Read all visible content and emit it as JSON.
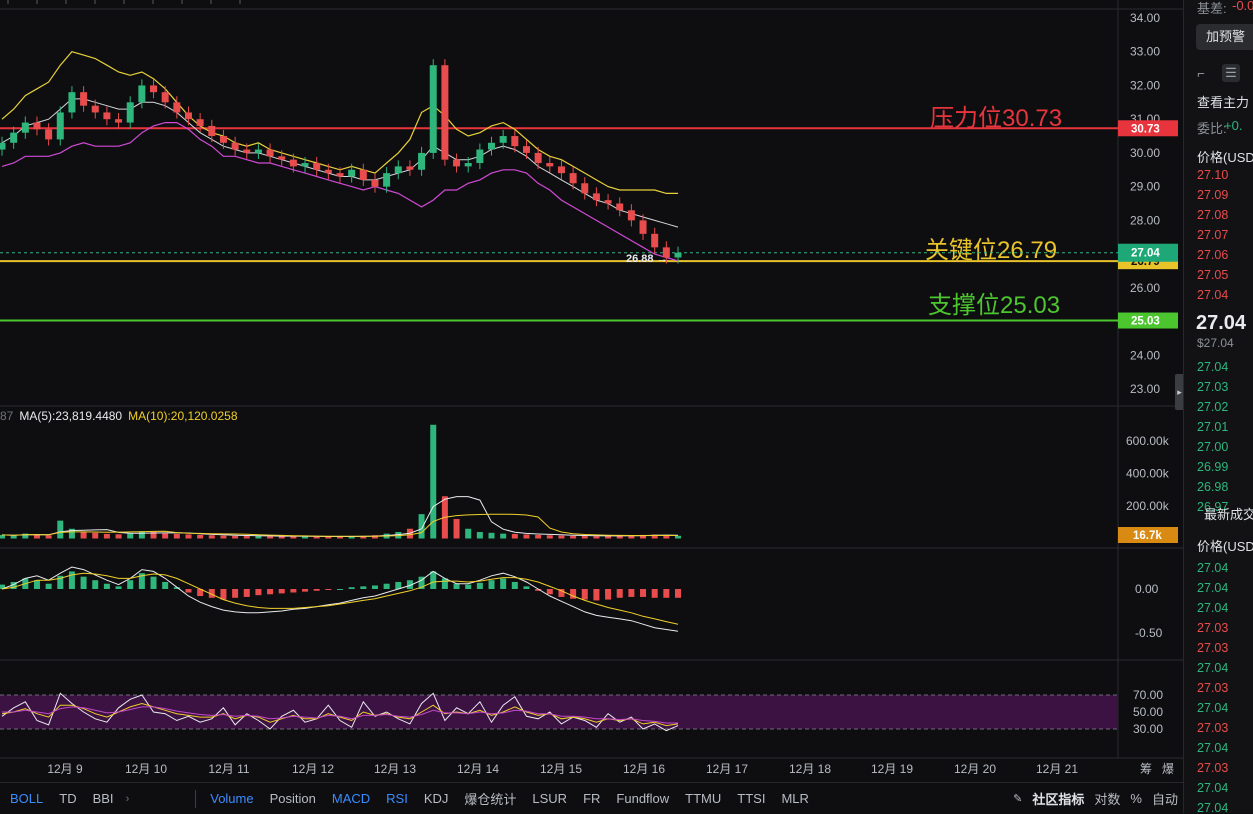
{
  "chart_data": {
    "type": "candlestick",
    "symbol_quote": "USD",
    "x_tick_labels": [
      "12月 9",
      "12月 10",
      "12月 11",
      "12月 12",
      "12月 13",
      "12月 14",
      "12月 15",
      "12月 16",
      "12月 17",
      "12月 18",
      "12月 19",
      "12月 20",
      "12月 21"
    ],
    "price_axis": {
      "ticks": [
        "34.00",
        "33.00",
        "32.00",
        "31.00",
        "30.00",
        "29.00",
        "28.00",
        "27.00",
        "26.00",
        "25.00",
        "24.00",
        "23.00"
      ],
      "range": [
        22.8,
        34.4
      ]
    },
    "last_price": 27.04,
    "last_price_label": "27.04",
    "low_marker": "26.88",
    "series_close": [
      30.3,
      30.6,
      30.9,
      30.7,
      30.4,
      31.2,
      31.8,
      31.4,
      31.2,
      31.0,
      30.9,
      31.5,
      32.0,
      31.8,
      31.5,
      31.2,
      31.0,
      30.8,
      30.5,
      30.3,
      30.1,
      30.0,
      30.1,
      29.9,
      29.8,
      29.6,
      29.7,
      29.5,
      29.4,
      29.3,
      29.5,
      29.2,
      29.0,
      29.4,
      29.6,
      29.5,
      30.0,
      32.6,
      29.8,
      29.6,
      29.7,
      30.1,
      30.3,
      30.5,
      30.2,
      30.0,
      29.7,
      29.6,
      29.4,
      29.1,
      28.8,
      28.6,
      28.5,
      28.3,
      28.0,
      27.6,
      27.2,
      26.9,
      27.04
    ],
    "bollinger": {
      "upper": [
        31.0,
        31.3,
        31.7,
        31.9,
        32.1,
        32.6,
        33.0,
        32.9,
        32.8,
        32.6,
        32.4,
        32.3,
        32.4,
        32.2,
        31.9,
        31.5,
        31.1,
        30.8,
        30.6,
        30.5,
        30.3,
        30.2,
        30.3,
        30.1,
        30.0,
        29.9,
        29.8,
        29.7,
        29.6,
        29.5,
        29.6,
        29.5,
        29.4,
        29.7,
        30.0,
        30.4,
        31.2,
        31.4,
        31.1,
        30.7,
        30.5,
        30.6,
        30.8,
        30.9,
        30.7,
        30.4,
        30.1,
        29.9,
        29.8,
        29.6,
        29.4,
        29.2,
        29.0,
        28.9,
        28.9,
        28.9,
        28.9,
        28.8,
        28.8
      ],
      "middle": [
        30.3,
        30.5,
        30.8,
        30.9,
        31.0,
        31.3,
        31.6,
        31.6,
        31.5,
        31.4,
        31.3,
        31.3,
        31.5,
        31.5,
        31.4,
        31.2,
        30.9,
        30.6,
        30.4,
        30.2,
        30.1,
        30.0,
        30.0,
        29.9,
        29.8,
        29.7,
        29.6,
        29.5,
        29.4,
        29.3,
        29.3,
        29.2,
        29.2,
        29.3,
        29.4,
        29.5,
        29.8,
        30.2,
        30.0,
        29.8,
        29.8,
        29.9,
        30.1,
        30.2,
        30.1,
        29.9,
        29.6,
        29.4,
        29.2,
        29.0,
        28.8,
        28.6,
        28.5,
        28.3,
        28.2,
        28.1,
        28.0,
        27.9,
        27.8
      ],
      "lower": [
        29.6,
        29.7,
        29.9,
        29.9,
        29.9,
        30.0,
        30.2,
        30.3,
        30.2,
        30.2,
        30.2,
        30.3,
        30.6,
        30.8,
        30.9,
        30.9,
        30.7,
        30.4,
        30.2,
        29.9,
        29.9,
        29.8,
        29.7,
        29.7,
        29.6,
        29.5,
        29.4,
        29.3,
        29.2,
        29.1,
        29.0,
        28.9,
        29.0,
        28.9,
        28.8,
        28.6,
        28.4,
        28.6,
        28.9,
        28.9,
        29.1,
        29.2,
        29.4,
        29.5,
        29.5,
        29.4,
        29.1,
        28.9,
        28.6,
        28.4,
        28.2,
        28.0,
        27.8,
        27.6,
        27.4,
        27.2,
        27.0,
        26.9,
        26.8
      ]
    },
    "levels": [
      {
        "name": "压力位30.73",
        "value": 30.73,
        "tag": "30.73",
        "color": "#e8353d"
      },
      {
        "name": "关键位26.79",
        "value": 26.79,
        "tag": "26.79",
        "color": "#e8c32a"
      },
      {
        "name": "支撑位25.03",
        "value": 25.03,
        "tag": "25.03",
        "color": "#4cc62e"
      }
    ],
    "volume": {
      "legend": [
        {
          "label": "MA(5):23,819.4480",
          "color": "#e8eaee"
        },
        {
          "label": "MA(10):20,120.0258",
          "color": "#f0d02b"
        }
      ],
      "legend_prefix": "87",
      "ticks": [
        "600.00k",
        "400.00k",
        "200.00k"
      ],
      "last_label": "16.7k",
      "values": [
        22,
        18,
        30,
        25,
        20,
        110,
        60,
        40,
        35,
        28,
        26,
        30,
        45,
        40,
        32,
        28,
        25,
        22,
        20,
        18,
        16,
        15,
        17,
        14,
        13,
        14,
        12,
        11,
        12,
        13,
        15,
        14,
        20,
        30,
        40,
        60,
        150,
        700,
        260,
        120,
        60,
        40,
        35,
        30,
        28,
        25,
        22,
        20,
        18,
        16,
        15,
        14,
        16,
        18,
        20,
        22,
        24,
        20,
        17
      ]
    },
    "macd": {
      "ticks": [
        "0.00",
        "-0.50"
      ],
      "hist": [
        0.05,
        0.08,
        0.12,
        0.1,
        0.06,
        0.15,
        0.2,
        0.14,
        0.1,
        0.06,
        0.03,
        0.1,
        0.18,
        0.14,
        0.08,
        0.02,
        -0.04,
        -0.08,
        -0.1,
        -0.12,
        -0.1,
        -0.09,
        -0.07,
        -0.06,
        -0.05,
        -0.04,
        -0.03,
        -0.02,
        -0.01,
        0.0,
        0.02,
        0.03,
        0.04,
        0.06,
        0.08,
        0.1,
        0.14,
        0.2,
        0.12,
        0.06,
        0.05,
        0.07,
        0.1,
        0.12,
        0.08,
        0.03,
        -0.02,
        -0.06,
        -0.09,
        -0.11,
        -0.12,
        -0.13,
        -0.12,
        -0.1,
        -0.09,
        -0.09,
        -0.1,
        -0.1,
        -0.1
      ],
      "dif": [
        0.0,
        0.05,
        0.12,
        0.15,
        0.1,
        0.18,
        0.25,
        0.22,
        0.16,
        0.1,
        0.05,
        0.12,
        0.22,
        0.2,
        0.12,
        0.02,
        -0.08,
        -0.15,
        -0.2,
        -0.24,
        -0.26,
        -0.27,
        -0.27,
        -0.26,
        -0.25,
        -0.23,
        -0.22,
        -0.2,
        -0.18,
        -0.16,
        -0.13,
        -0.1,
        -0.08,
        -0.04,
        0.0,
        0.04,
        0.1,
        0.2,
        0.12,
        0.06,
        0.06,
        0.1,
        0.15,
        0.18,
        0.14,
        0.08,
        0.0,
        -0.08,
        -0.14,
        -0.2,
        -0.26,
        -0.3,
        -0.32,
        -0.34,
        -0.36,
        -0.4,
        -0.44,
        -0.46,
        -0.48
      ],
      "dea": [
        0.0,
        0.02,
        0.06,
        0.1,
        0.1,
        0.12,
        0.16,
        0.18,
        0.17,
        0.15,
        0.12,
        0.12,
        0.15,
        0.17,
        0.16,
        0.12,
        0.06,
        0.0,
        -0.06,
        -0.12,
        -0.16,
        -0.19,
        -0.21,
        -0.22,
        -0.22,
        -0.22,
        -0.21,
        -0.2,
        -0.19,
        -0.17,
        -0.15,
        -0.13,
        -0.11,
        -0.08,
        -0.05,
        -0.02,
        0.02,
        0.08,
        0.09,
        0.09,
        0.08,
        0.09,
        0.11,
        0.13,
        0.13,
        0.11,
        0.08,
        0.03,
        -0.02,
        -0.08,
        -0.13,
        -0.17,
        -0.21,
        -0.24,
        -0.27,
        -0.31,
        -0.34,
        -0.37,
        -0.4
      ]
    },
    "rsi": {
      "ticks": [
        "70.00",
        "50.00",
        "30.00"
      ],
      "band": [
        30,
        70
      ],
      "line1": [
        45,
        55,
        62,
        40,
        35,
        72,
        60,
        50,
        42,
        38,
        55,
        65,
        70,
        50,
        48,
        40,
        45,
        38,
        42,
        55,
        35,
        48,
        40,
        30,
        45,
        52,
        38,
        42,
        58,
        40,
        32,
        62,
        45,
        50,
        42,
        36,
        60,
        72,
        40,
        55,
        48,
        62,
        38,
        58,
        68,
        45,
        42,
        50,
        36,
        44,
        40,
        32,
        48,
        38,
        44,
        30,
        36,
        28,
        34
      ],
      "line2": [
        48,
        50,
        54,
        48,
        44,
        58,
        58,
        54,
        48,
        44,
        50,
        56,
        60,
        56,
        52,
        48,
        46,
        44,
        44,
        48,
        42,
        46,
        44,
        38,
        42,
        46,
        42,
        42,
        48,
        44,
        40,
        50,
        46,
        48,
        44,
        42,
        50,
        58,
        48,
        50,
        48,
        52,
        46,
        50,
        56,
        50,
        46,
        48,
        42,
        44,
        42,
        38,
        42,
        40,
        42,
        36,
        38,
        34,
        36
      ],
      "line3": [
        50,
        50,
        52,
        50,
        48,
        54,
        56,
        55,
        52,
        49,
        50,
        53,
        56,
        56,
        54,
        51,
        49,
        47,
        46,
        47,
        45,
        46,
        45,
        42,
        43,
        45,
        44,
        43,
        46,
        45,
        42,
        46,
        46,
        47,
        45,
        44,
        47,
        52,
        49,
        49,
        48,
        50,
        48,
        49,
        52,
        51,
        48,
        48,
        45,
        45,
        44,
        42,
        42,
        41,
        42,
        40,
        39,
        37,
        37
      ]
    }
  },
  "bottom_bar": {
    "left_tabs": [
      {
        "label": "BOLL",
        "active": true
      },
      {
        "label": "TD",
        "active": false
      },
      {
        "label": "BBI",
        "active": false
      }
    ],
    "more_chev": "›",
    "mid_tabs": [
      {
        "label": "Volume",
        "active": true
      },
      {
        "label": "Position",
        "active": false
      },
      {
        "label": "MACD",
        "active": true
      },
      {
        "label": "RSI",
        "active": true
      },
      {
        "label": "KDJ",
        "active": false
      },
      {
        "label": "爆仓统计",
        "active": false
      },
      {
        "label": "LSUR",
        "active": false
      },
      {
        "label": "FR",
        "active": false
      },
      {
        "label": "Fundflow",
        "active": false
      },
      {
        "label": "TTMU",
        "active": false
      },
      {
        "label": "TTSI",
        "active": false
      },
      {
        "label": "MLR",
        "active": false
      }
    ],
    "community": "社区指标",
    "right_tabs": [
      "对数",
      "%",
      "自动"
    ]
  },
  "axis_corner": [
    "筹",
    "爆"
  ],
  "right_panel": {
    "basis_label": "基差:",
    "basis_value": "-0.0",
    "alert_button": "加预警",
    "main_force_title": "查看主力",
    "commission_label": "委比:",
    "commission_value": "+0.",
    "price_header": "价格(USD",
    "ask_prices": [
      "27.10",
      "27.09",
      "27.08",
      "27.07",
      "27.06",
      "27.05",
      "27.04"
    ],
    "big_price": "27.04",
    "sub_price": "$27.04",
    "bid_prices": [
      "27.04",
      "27.03",
      "27.02",
      "27.01",
      "27.00",
      "26.99",
      "26.98",
      "26.97"
    ],
    "trades_title": "最新成交",
    "trades_header": "价格(USD",
    "trade_prices": [
      {
        "p": "27.04",
        "side": "buy"
      },
      {
        "p": "27.04",
        "side": "buy"
      },
      {
        "p": "27.04",
        "side": "buy"
      },
      {
        "p": "27.03",
        "side": "sell"
      },
      {
        "p": "27.03",
        "side": "sell"
      },
      {
        "p": "27.04",
        "side": "buy"
      },
      {
        "p": "27.03",
        "side": "sell"
      },
      {
        "p": "27.04",
        "side": "buy"
      },
      {
        "p": "27.03",
        "side": "sell"
      },
      {
        "p": "27.04",
        "side": "buy"
      },
      {
        "p": "27.03",
        "side": "sell"
      },
      {
        "p": "27.04",
        "side": "buy"
      },
      {
        "p": "27.04",
        "side": "buy"
      }
    ],
    "colors": {
      "up": "#2eb67d",
      "down": "#e84c4c"
    }
  }
}
